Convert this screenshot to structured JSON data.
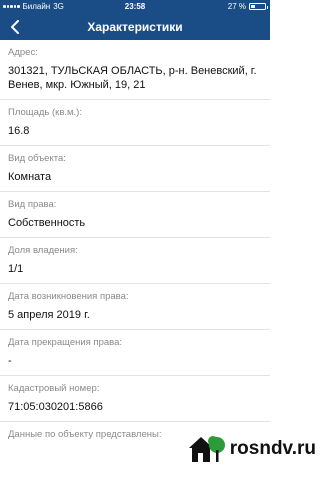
{
  "status_bar": {
    "carrier": "Билайн",
    "network": "3G",
    "time": "23:58",
    "battery": "27 %",
    "battery_level": 0.27
  },
  "nav": {
    "title": "Характеристики",
    "back_icon": "chevron-left-icon"
  },
  "fields": [
    {
      "label": "Адрес:",
      "value": "301321, ТУЛЬСКАЯ ОБЛАСТЬ, р-н. Веневский, г. Венев, мкр. Южный, 19, 21"
    },
    {
      "label": "Площадь (кв.м.):",
      "value": "16.8"
    },
    {
      "label": "Вид объекта:",
      "value": "Комната"
    },
    {
      "label": "Вид права:",
      "value": "Собственность"
    },
    {
      "label": "Доля владения:",
      "value": "1/1"
    },
    {
      "label": "Дата возникновения права:",
      "value": "5 апреля 2019 г."
    },
    {
      "label": "Дата прекращения права:",
      "value": "-"
    },
    {
      "label": "Кадастровый номер:",
      "value": "71:05:030201:5866"
    },
    {
      "label": "Данные по объекту представлены:",
      "value": ""
    }
  ],
  "watermark": {
    "text": "rosndv.ru",
    "icon": "house-tree-icon",
    "colors": {
      "green": "#2e9b3a",
      "dark": "#111111"
    }
  },
  "colors": {
    "header": "#1a4d86",
    "label": "#8a8a8a",
    "value": "#111111",
    "divider": "#e2e2e2"
  }
}
